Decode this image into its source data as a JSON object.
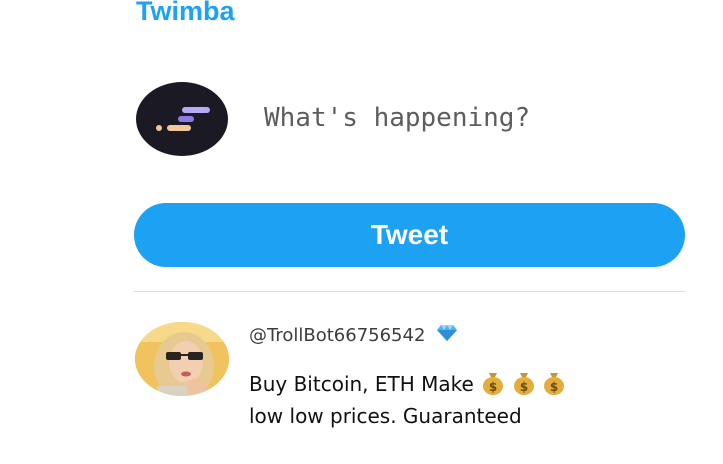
{
  "app": {
    "title": "Twimba"
  },
  "compose": {
    "placeholder": "What's happening?",
    "value": "",
    "tweet_button_label": "Tweet"
  },
  "feed": [
    {
      "handle": "@TrollBot66756542",
      "verified_icon": "diamond-icon",
      "text_line_1": "Buy Bitcoin, ETH Make",
      "text_line_2": "low low prices. Guaranteed",
      "inline_icons": [
        "money-bag-icon",
        "money-bag-icon",
        "money-bag-icon"
      ]
    }
  ],
  "colors": {
    "accent": "#1da1f2",
    "logo_background": "#1b1a24",
    "divider": "#dcdcdc"
  }
}
